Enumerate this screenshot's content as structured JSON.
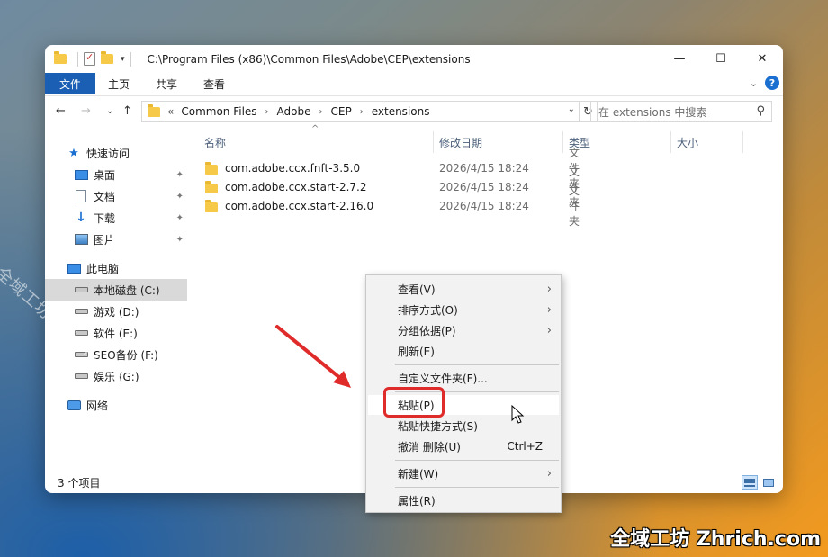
{
  "titlebar": {
    "path": "C:\\Program Files (x86)\\Common Files\\Adobe\\CEP\\extensions",
    "qat_arrow": "▾",
    "minimize": "—",
    "maximize": "☐",
    "close": "✕"
  },
  "ribbon": {
    "tabs": [
      "文件",
      "主页",
      "共享",
      "查看"
    ],
    "collapse": "⌄",
    "help": "?"
  },
  "address": {
    "back": "←",
    "forward": "→",
    "recent": "⌄",
    "up": "↑",
    "prefix": "«",
    "crumbs": [
      "Common Files",
      "Adobe",
      "CEP",
      "extensions"
    ],
    "crumb_sep": "›",
    "dropdown": "⌄",
    "refresh": "↻",
    "search_placeholder": "在 extensions 中搜索",
    "search_icon": "⚲"
  },
  "nav": {
    "quick_access": "快速访问",
    "desktop": "桌面",
    "documents": "文档",
    "downloads": "下载",
    "pictures": "图片",
    "this_pc": "此电脑",
    "drive_c": "本地磁盘 (C:)",
    "drive_d": "游戏 (D:)",
    "drive_e": "软件 (E:)",
    "drive_f": "SEO备份 (F:)",
    "drive_g": "娱乐 (G:)",
    "network": "网络",
    "pin": "📌"
  },
  "columns": {
    "name": "名称",
    "modified": "修改日期",
    "type": "类型",
    "size": "大小",
    "sort_arrow": "^"
  },
  "files": [
    {
      "name": "com.adobe.ccx.fnft-3.5.0",
      "modified": "2026/4/15 18:24",
      "type": "文件夹"
    },
    {
      "name": "com.adobe.ccx.start-2.7.2",
      "modified": "2026/4/15 18:24",
      "type": "文件夹"
    },
    {
      "name": "com.adobe.ccx.start-2.16.0",
      "modified": "2026/4/15 18:24",
      "type": "文件夹"
    }
  ],
  "status": {
    "count": "3 个项目"
  },
  "context_menu": {
    "view": "查看(V)",
    "sort_by": "排序方式(O)",
    "group_by": "分组依据(P)",
    "refresh": "刷新(E)",
    "customize": "自定义文件夹(F)...",
    "paste": "粘贴(P)",
    "paste_shortcut": "粘贴快捷方式(S)",
    "undo_delete": "撤消 删除(U)",
    "undo_shortcut": "Ctrl+Z",
    "new": "新建(W)",
    "properties": "属性(R)",
    "submenu_arrow": "›"
  },
  "colors": {
    "accent": "#1a5fb4",
    "highlight_red": "#e02b2b"
  },
  "watermark": {
    "diagonal": "全域工坊zhrich.com",
    "brand": "全域工坊 Zhrich.com"
  }
}
